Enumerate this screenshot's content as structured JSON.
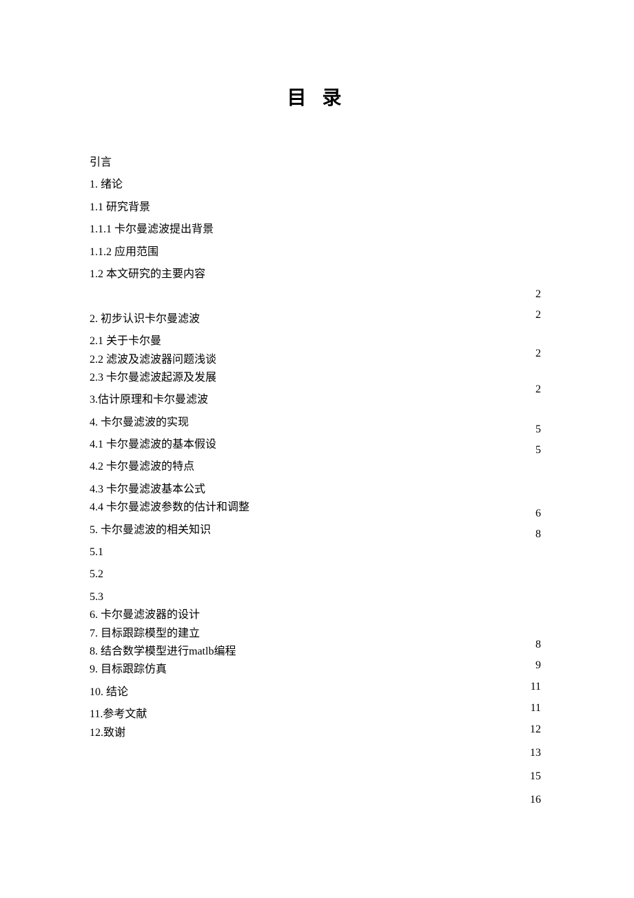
{
  "title": "目 录",
  "toc": {
    "items": [
      "引言",
      "1. 绪论",
      "1.1 研究背景",
      "1.1.1 卡尔曼滤波提出背景",
      "1.1.2 应用范围",
      "1.2 本文研究的主要内容",
      "",
      "2. 初步认识卡尔曼滤波",
      "2.1 关于卡尔曼",
      "2.2 滤波及滤波器问题浅谈",
      "2.3 卡尔曼滤波起源及发展",
      "3.估计原理和卡尔曼滤波",
      "4. 卡尔曼滤波的实现",
      "4.1 卡尔曼滤波的基本假设",
      "4.2 卡尔曼滤波的特点",
      "4.3 卡尔曼滤波基本公式",
      "4.4 卡尔曼滤波参数的估计和调整",
      "5. 卡尔曼滤波的相关知识",
      "5.1",
      "5.2",
      "5.3",
      "6. 卡尔曼滤波器的设计",
      "7. 目标跟踪模型的建立",
      "8. 结合数学模型进行matlb编程",
      "9. 目标跟踪仿真",
      "10. 结论",
      "11.参考文献",
      "12.致谢"
    ]
  },
  "page_numbers": [
    "2",
    "2",
    "2",
    "2",
    "5",
    "5",
    "6",
    "8",
    "8",
    "9",
    "11",
    "11",
    "12",
    "13",
    "15",
    "16"
  ]
}
